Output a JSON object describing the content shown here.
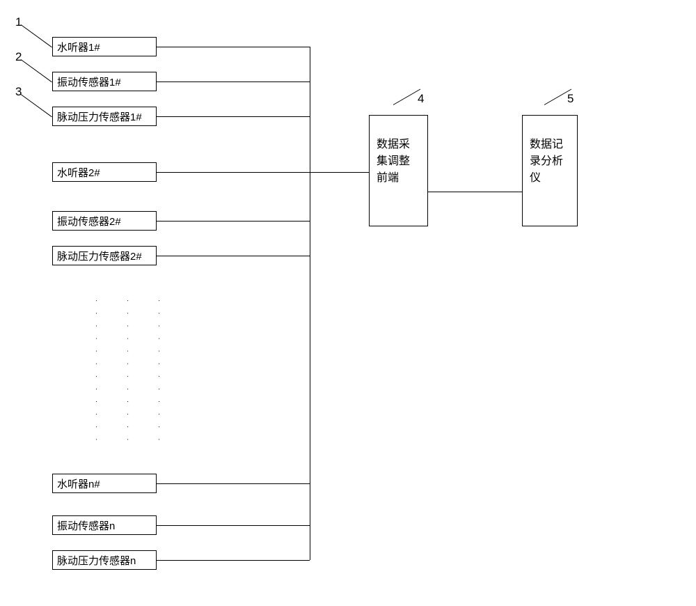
{
  "labels": {
    "l1": "1",
    "l2": "2",
    "l3": "3",
    "l4": "4",
    "l5": "5"
  },
  "sensors": {
    "s1a": "水听器1#",
    "s1b": "振动传感器1#",
    "s1c": "脉动压力传感器1#",
    "s2a": "水听器2#",
    "s2b": "振动传感器2#",
    "s2c": "脉动压力传感器2#",
    "sna": "水听器n#",
    "snb": "振动传感器n",
    "snc": "脉动压力传感器n"
  },
  "collector": "数据采集调整前端",
  "analyzer": "数据记录分析仪"
}
